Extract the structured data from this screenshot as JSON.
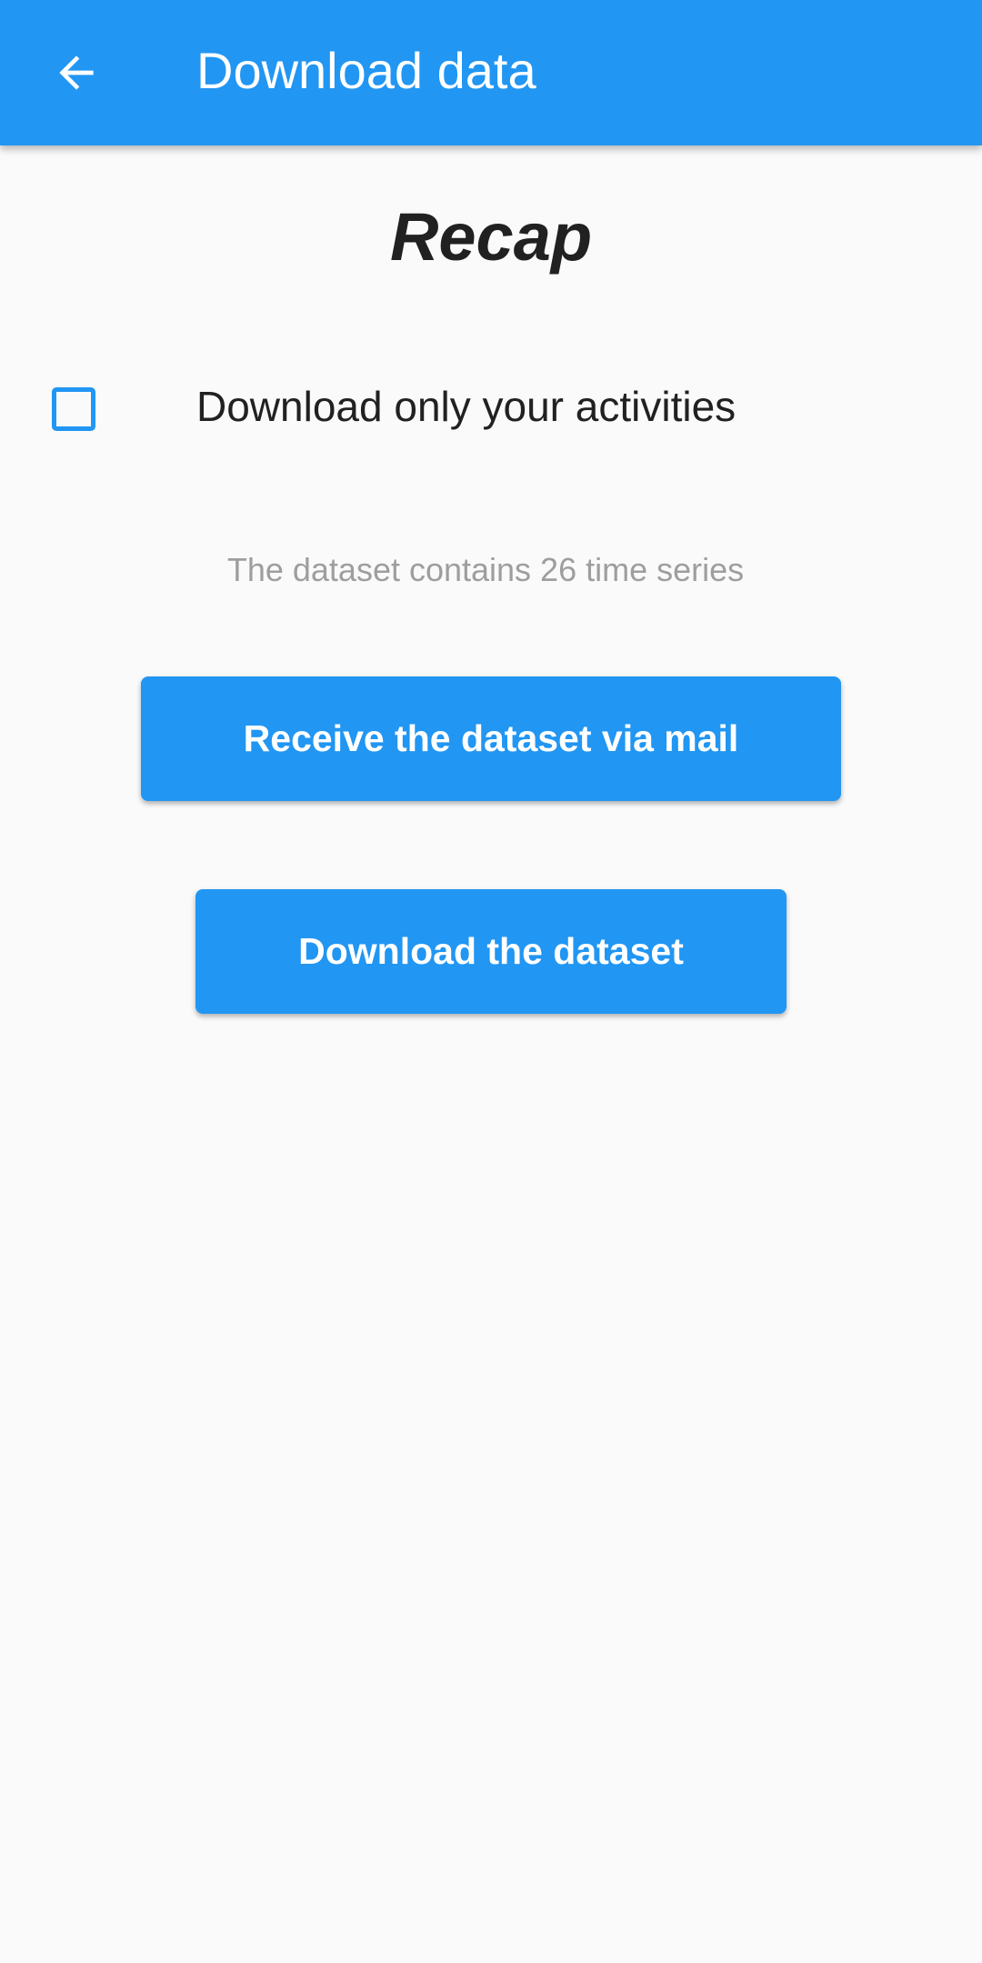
{
  "app_bar": {
    "title": "Download data",
    "back_icon": "arrow-back-icon",
    "background_color": "#2196f3"
  },
  "content": {
    "heading": "Recap",
    "checkbox": {
      "label": "Download only your activities",
      "checked": false,
      "color": "#2196f3"
    },
    "info_text": "The dataset contains 26 time series",
    "buttons": {
      "mail_label": "Receive the dataset via mail",
      "download_label": "Download the dataset",
      "color": "#2196f3"
    }
  }
}
